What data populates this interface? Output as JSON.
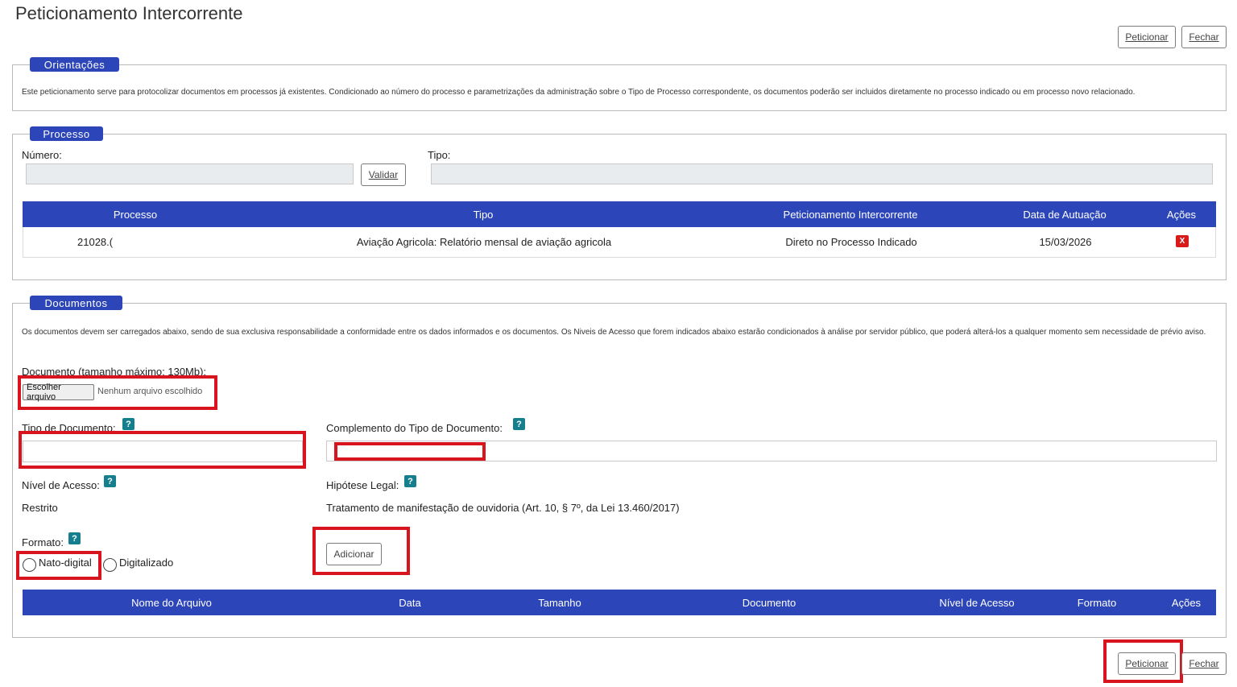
{
  "page": {
    "title": "Peticionamento Intercorrente"
  },
  "top_actions": {
    "peticionar": "Peticionar",
    "fechar": "Fechar"
  },
  "orientacoes": {
    "legend": "Orientações",
    "text": "Este peticionamento serve para protocolizar documentos em processos já existentes. Condicionado ao número do processo e parametrizações da administração sobre o Tipo de Processo correspondente, os documentos poderão ser incluidos diretamente no processo indicado ou em processo novo relacionado."
  },
  "processo": {
    "legend": "Processo",
    "numero_label": "Número:",
    "numero_value": "",
    "validar_button": "Validar",
    "tipo_label": "Tipo:",
    "tipo_value": "",
    "table": {
      "columns": [
        "Processo",
        "Tipo",
        "Peticionamento Intercorrente",
        "Data de Autuação",
        "Ações"
      ],
      "rows": [
        {
          "processo": "21028.(",
          "tipo": "Aviação Agricola: Relatório mensal de aviação agricola",
          "peticionamento": "Direto no Processo Indicado",
          "data": "15/03/2026",
          "acao_icon": "delete-icon",
          "acao_glyph": "X"
        }
      ]
    }
  },
  "documentos": {
    "legend": "Documentos",
    "info": "Os documentos devem ser carregados abaixo, sendo de sua exclusiva responsabilidade a conformidade entre os dados informados e os documentos. Os Niveis de Acesso que forem indicados abaixo estarão condicionados à análise por servidor público, que poderá alterá-los a qualquer momento sem necessidade de prévio aviso.",
    "documento_label": "Documento (tamanho máximo: 130Mb):",
    "file_button": "Escolher arquivo",
    "file_status": "Nenhum arquivo escolhido",
    "tipo_documento_label": "Tipo de Documento:",
    "tipo_documento_value": "",
    "complemento_label": "Complemento do Tipo de Documento:",
    "complemento_value": "",
    "nivel_acesso_label": "Nível de Acesso:",
    "nivel_acesso_value": "Restrito",
    "hipotese_label": "Hipótese Legal:",
    "hipotese_value": "Tratamento de manifestação de ouvidoria (Art. 10, § 7º, da Lei 13.460/2017)",
    "formato_label": "Formato:",
    "formato_options": [
      "Nato-digital",
      "Digitalizado"
    ],
    "adicionar_button": "Adicionar",
    "help_glyph": "?",
    "table": {
      "columns": [
        "Nome do Arquivo",
        "Data",
        "Tamanho",
        "Documento",
        "Nível de Acesso",
        "Formato",
        "Ações"
      ]
    }
  },
  "bottom_actions": {
    "peticionar": "Peticionar",
    "fechar": "Fechar"
  },
  "colors": {
    "accent": "#2c45b8",
    "help": "#167f8e",
    "highlight": "#d8151f",
    "delete": "#d81a1a"
  }
}
